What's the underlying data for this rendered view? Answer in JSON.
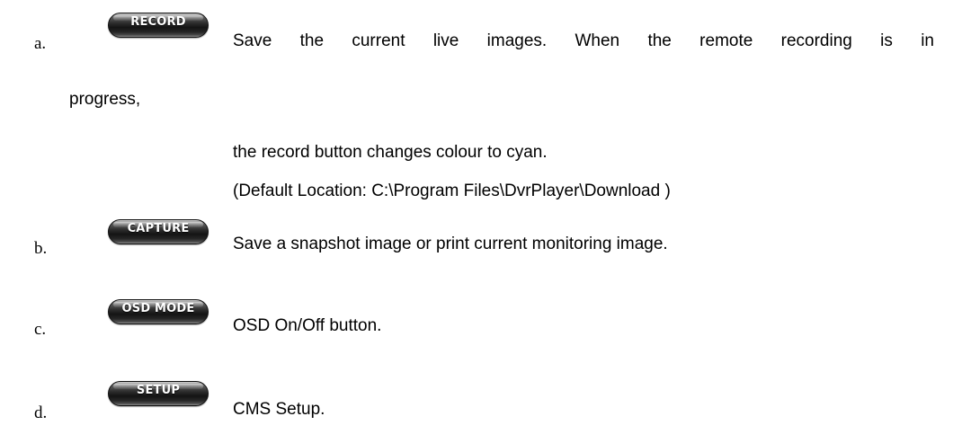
{
  "items": [
    {
      "marker": "a.",
      "button_label": "RECORD",
      "description_line1": "Save the current live images. When the remote recording is in",
      "description_line2": "progress,",
      "description_line3": "the record button changes colour to cyan.",
      "description_line4": "(Default Location: C:\\Program Files\\DvrPlayer\\Download )"
    },
    {
      "marker": "b.",
      "button_label": "CAPTURE",
      "description": "Save a snapshot image or print current monitoring image."
    },
    {
      "marker": "c.",
      "button_label": "OSD MODE",
      "description": "OSD On/Off button."
    },
    {
      "marker": "d.",
      "button_label": "SETUP",
      "description": "CMS Setup."
    }
  ]
}
